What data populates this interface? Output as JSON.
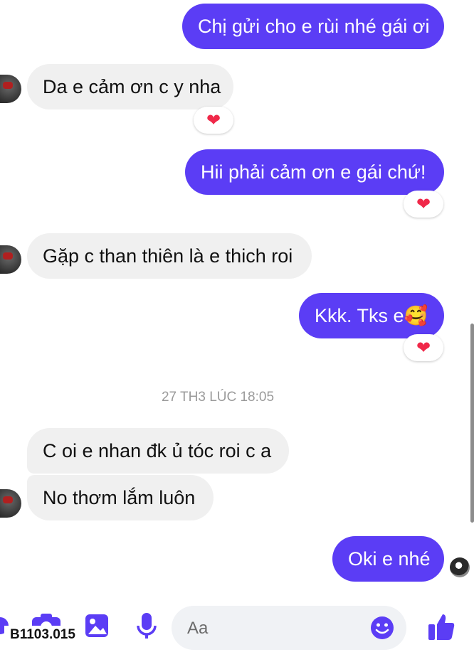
{
  "conversation": {
    "messages": [
      {
        "text": "Chị gửi cho e rùi nhé gái ơi",
        "sender": "me"
      },
      {
        "text": "Da e cảm ơn c y nha",
        "sender": "other",
        "reaction": "heart"
      },
      {
        "text": "Hii phải cảm ơn e gái chứ!",
        "sender": "me",
        "reaction": "heart"
      },
      {
        "text": "Gặp c than thiên là e thich roi",
        "sender": "other"
      },
      {
        "text": "Kkk. Tks e🥰",
        "sender": "me",
        "reaction": "heart"
      },
      {
        "text": "C oi e nhan đk ủ tóc roi c a",
        "sender": "other"
      },
      {
        "text": "No thơm lắm luôn",
        "sender": "other"
      },
      {
        "text": "Oki e nhé",
        "sender": "me"
      }
    ],
    "timestamp": "27 TH3 LÚC 18:05"
  },
  "composer": {
    "placeholder": "Aa",
    "icons": [
      "plus-icon",
      "camera-icon",
      "gallery-icon",
      "microphone-icon",
      "emoji-icon",
      "thumbs-up-icon"
    ]
  },
  "watermark": {
    "text": "B1103.015"
  },
  "colors": {
    "outgoing_bubble": "#5b3df5",
    "incoming_bubble": "#f0f0f0",
    "reaction_heart": "#f02849",
    "accent_icons": "#5b3df5"
  }
}
